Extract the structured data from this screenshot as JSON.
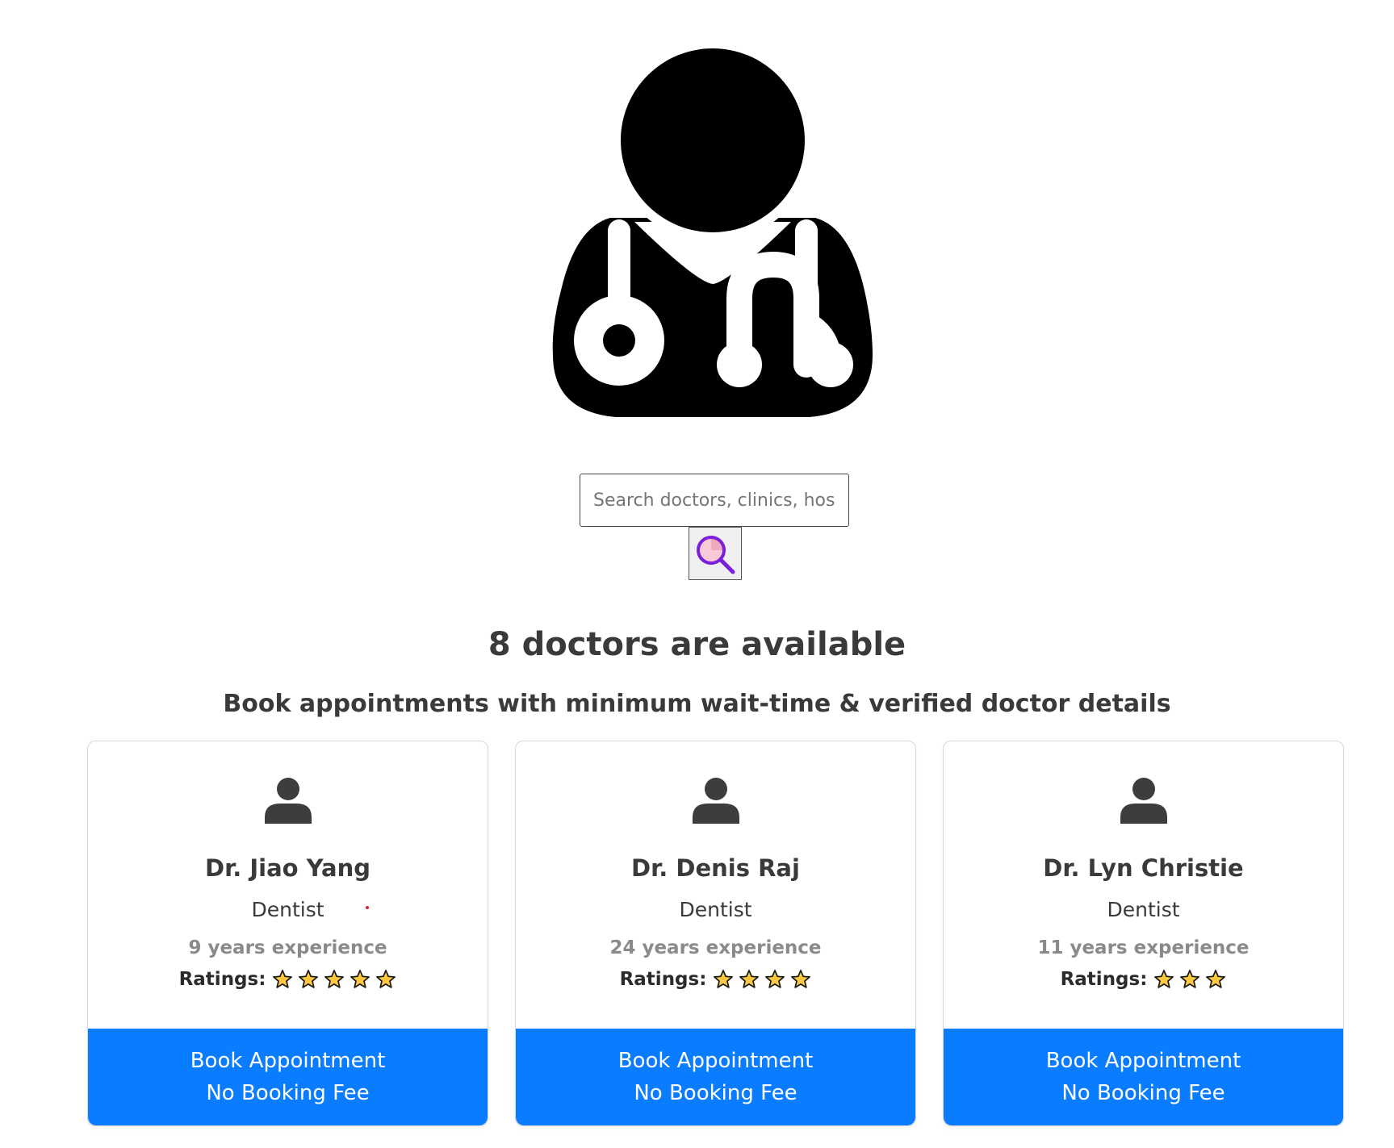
{
  "hero": {
    "icon": "doctor-stethoscope-icon"
  },
  "search": {
    "placeholder": "Search doctors, clinics, hospitals, etc.",
    "value": "",
    "button_icon": "magnifier-icon"
  },
  "headings": {
    "count": "8 doctors are available",
    "subtitle": "Book appointments with minimum wait-time & verified doctor details"
  },
  "doctors": [
    {
      "name": "Dr. Jiao Yang",
      "specialty": "Dentist",
      "experience": "9 years experience",
      "ratings_label": "Ratings:",
      "stars": 5,
      "book_label": "Book Appointment",
      "fee_label": "No Booking Fee"
    },
    {
      "name": "Dr. Denis Raj",
      "specialty": "Dentist",
      "experience": "24 years experience",
      "ratings_label": "Ratings:",
      "stars": 4,
      "book_label": "Book Appointment",
      "fee_label": "No Booking Fee"
    },
    {
      "name": "Dr. Lyn Christie",
      "specialty": "Dentist",
      "experience": "11 years experience",
      "ratings_label": "Ratings:",
      "stars": 3,
      "book_label": "Book Appointment",
      "fee_label": "No Booking Fee"
    }
  ],
  "colors": {
    "accent": "#0a7cff",
    "star_fill": "#ffc83d",
    "heading_text": "#3a3a3c",
    "muted_text": "#8a8a8a"
  }
}
